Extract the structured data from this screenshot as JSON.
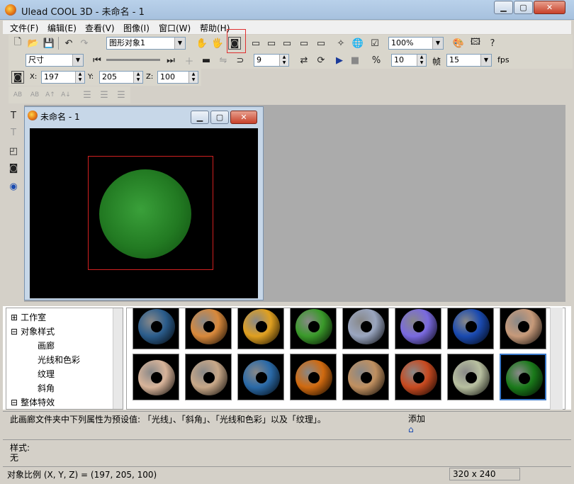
{
  "window": {
    "title": "Ulead COOL 3D - 未命名 - 1",
    "min": "▁",
    "max": "▢",
    "close": "✕"
  },
  "menus": [
    "文件(F)",
    "编辑(E)",
    "查看(V)",
    "图像(I)",
    "窗口(W)",
    "帮助(H)"
  ],
  "toolbar1": {
    "object_select": "图形对象1",
    "zoom": "100%"
  },
  "toolbar2": {
    "size_select": "尺寸",
    "frame_count": "9",
    "frame_rate": "10",
    "frame_label": "帧",
    "fps_value": "15",
    "fps_label": "fps"
  },
  "toolbar3": {
    "x_label": "X:",
    "x": "197",
    "y_label": "Y:",
    "y": "205",
    "z_label": "Z:",
    "z": "100"
  },
  "doc": {
    "title": "未命名 - 1"
  },
  "tree": {
    "items": [
      {
        "prefix": "⊞",
        "label": "工作室"
      },
      {
        "prefix": "⊟",
        "label": "对象样式"
      },
      {
        "prefix": "",
        "label": "画廊"
      },
      {
        "prefix": "",
        "label": "光线和色彩"
      },
      {
        "prefix": "",
        "label": "纹理"
      },
      {
        "prefix": "",
        "label": "斜角"
      },
      {
        "prefix": "⊟",
        "label": "整体特效"
      }
    ]
  },
  "description": "此画廊文件夹中下列属性为预设值: 「光线」、「斜角」、「光线和色彩」以及「纹理」。",
  "add_label": "添加",
  "style": {
    "label": "样式:",
    "value": "无"
  },
  "status": {
    "text": "对象比例 (X, Y, Z) = (197, 205, 100)",
    "resolution": "320 x 240"
  },
  "gallery_colors": [
    "#2b5d8c",
    "#d9893b",
    "#e0a020",
    "#3a9a2a",
    "#9aa6c0",
    "#7a6ae0",
    "#1a4ab0",
    "#c79a7a",
    "#d8b49a",
    "#c8a888",
    "#2a6aa8",
    "#d06a10",
    "#c09060",
    "#c84a20",
    "#b8c0a0",
    "#1a7a1a"
  ]
}
